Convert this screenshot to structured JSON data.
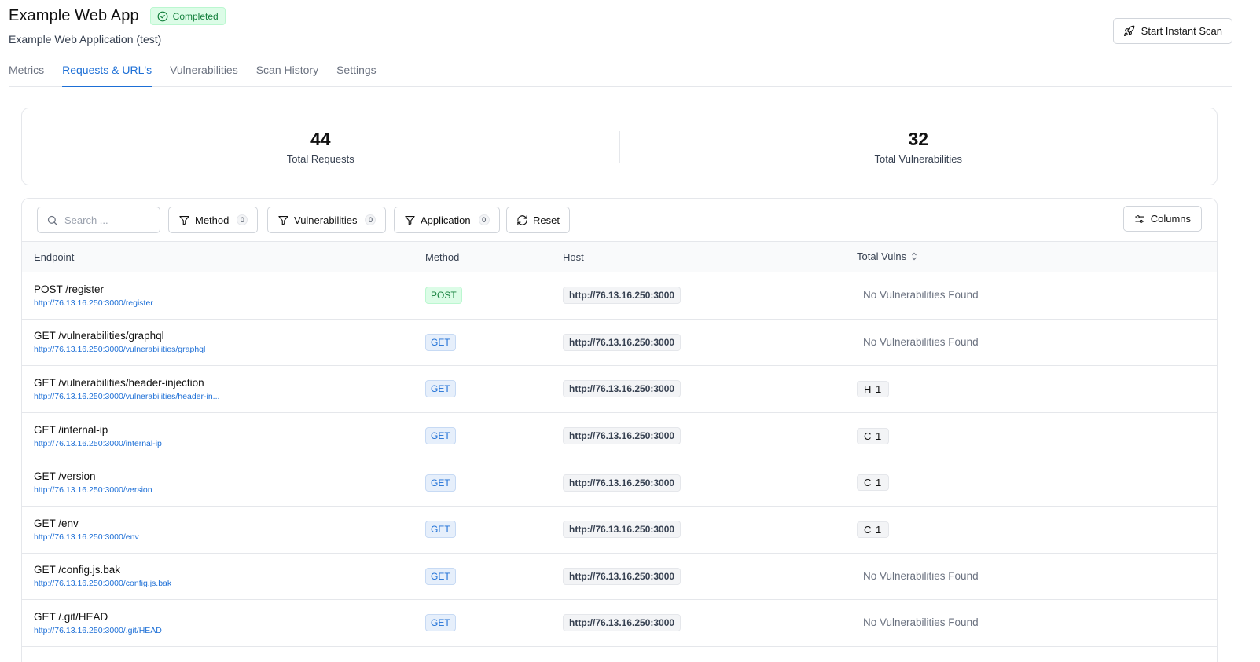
{
  "header": {
    "title": "Example Web App",
    "status": "Completed",
    "subtitle": "Example Web Application (test)",
    "scan_button": "Start Instant Scan"
  },
  "tabs": [
    {
      "label": "Metrics",
      "active": false
    },
    {
      "label": "Requests & URL's",
      "active": true
    },
    {
      "label": "Vulnerabilities",
      "active": false
    },
    {
      "label": "Scan History",
      "active": false
    },
    {
      "label": "Settings",
      "active": false
    }
  ],
  "stats": [
    {
      "value": "44",
      "label": "Total Requests"
    },
    {
      "value": "32",
      "label": "Total Vulnerabilities"
    }
  ],
  "toolbar": {
    "search_placeholder": "Search ...",
    "filters": [
      {
        "label": "Method",
        "count": "0"
      },
      {
        "label": "Vulnerabilities",
        "count": "0"
      },
      {
        "label": "Application",
        "count": "0"
      }
    ],
    "reset_label": "Reset",
    "columns_label": "Columns"
  },
  "table": {
    "columns": [
      "Endpoint",
      "Method",
      "Host",
      "Total Vulns"
    ],
    "rows": [
      {
        "endpoint": "POST /register",
        "url": "http://76.13.16.250:3000/register",
        "method": "POST",
        "host": "http://76.13.16.250:3000",
        "vulns": "No Vulnerabilities Found",
        "has_vulns": false
      },
      {
        "endpoint": "GET /vulnerabilities/graphql",
        "url": "http://76.13.16.250:3000/vulnerabilities/graphql",
        "method": "GET",
        "host": "http://76.13.16.250:3000",
        "vulns": "No Vulnerabilities Found",
        "has_vulns": false
      },
      {
        "endpoint": "GET /vulnerabilities/header-injection",
        "url": "http://76.13.16.250:3000/vulnerabilities/header-in...",
        "method": "GET",
        "host": "http://76.13.16.250:3000",
        "vulns": "H 1",
        "has_vulns": true
      },
      {
        "endpoint": "GET /internal-ip",
        "url": "http://76.13.16.250:3000/internal-ip",
        "method": "GET",
        "host": "http://76.13.16.250:3000",
        "vulns": "C 1",
        "has_vulns": true
      },
      {
        "endpoint": "GET /version",
        "url": "http://76.13.16.250:3000/version",
        "method": "GET",
        "host": "http://76.13.16.250:3000",
        "vulns": "C 1",
        "has_vulns": true
      },
      {
        "endpoint": "GET /env",
        "url": "http://76.13.16.250:3000/env",
        "method": "GET",
        "host": "http://76.13.16.250:3000",
        "vulns": "C 1",
        "has_vulns": true
      },
      {
        "endpoint": "GET /config.js.bak",
        "url": "http://76.13.16.250:3000/config.js.bak",
        "method": "GET",
        "host": "http://76.13.16.250:3000",
        "vulns": "No Vulnerabilities Found",
        "has_vulns": false
      },
      {
        "endpoint": "GET /.git/HEAD",
        "url": "http://76.13.16.250:3000/.git/HEAD",
        "method": "GET",
        "host": "http://76.13.16.250:3000",
        "vulns": "No Vulnerabilities Found",
        "has_vulns": false
      }
    ]
  },
  "colors": {
    "accent": "#1d6fd6",
    "success": "#15803d",
    "success_bg": "#dcfce7"
  }
}
